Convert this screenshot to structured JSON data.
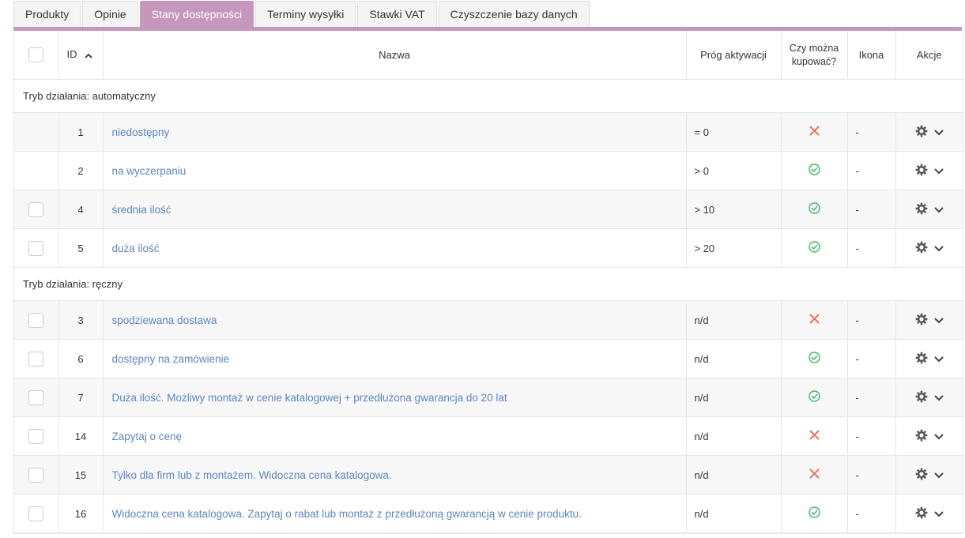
{
  "tabs": [
    {
      "label": "Produkty",
      "active": false
    },
    {
      "label": "Opinie",
      "active": false
    },
    {
      "label": "Stany dostępności",
      "active": true
    },
    {
      "label": "Terminy wysyłki",
      "active": false
    },
    {
      "label": "Stawki VAT",
      "active": false
    },
    {
      "label": "Czyszczenie bazy danych",
      "active": false
    }
  ],
  "colors": {
    "accent": "#c697bd",
    "link": "#5b86c5",
    "no": "#e8735f",
    "yes": "#3fb96a"
  },
  "table": {
    "headers": {
      "id": "ID",
      "name": "Nazwa",
      "threshold": "Próg aktywacji",
      "buyable_line1": "Czy można",
      "buyable_line2": "kupować?",
      "icon": "Ikona",
      "actions": "Akcje"
    },
    "groups": [
      {
        "title": "Tryb działania: automatyczny",
        "rows": [
          {
            "id": "1",
            "name": "niedostępny",
            "threshold": "= 0",
            "buyable": false,
            "icon": "-",
            "checkbox": false
          },
          {
            "id": "2",
            "name": "na wyczerpaniu",
            "threshold": "> 0",
            "buyable": true,
            "icon": "-",
            "checkbox": false
          },
          {
            "id": "4",
            "name": "średnia ilość",
            "threshold": "> 10",
            "buyable": true,
            "icon": "-",
            "checkbox": true
          },
          {
            "id": "5",
            "name": "duża ilość",
            "threshold": "> 20",
            "buyable": true,
            "icon": "-",
            "checkbox": true
          }
        ]
      },
      {
        "title": "Tryb działania: ręczny",
        "rows": [
          {
            "id": "3",
            "name": "spodziewana dostawa",
            "threshold": "n/d",
            "buyable": false,
            "icon": "-",
            "checkbox": true
          },
          {
            "id": "6",
            "name": "dostępny na zamówienie",
            "threshold": "n/d",
            "buyable": true,
            "icon": "-",
            "checkbox": true
          },
          {
            "id": "7",
            "name": "Duża ilość. Możliwy montaż w cenie katalogowej + przedłużona gwarancja do 20 lat",
            "threshold": "n/d",
            "buyable": true,
            "icon": "-",
            "checkbox": true
          },
          {
            "id": "14",
            "name": "Zapytaj o cenę",
            "threshold": "n/d",
            "buyable": false,
            "icon": "-",
            "checkbox": true
          },
          {
            "id": "15",
            "name": "Tylko dla firm lub z montażem. Widoczna cena katalogowa.",
            "threshold": "n/d",
            "buyable": false,
            "icon": "-",
            "checkbox": true
          },
          {
            "id": "16",
            "name": "Widoczna cena katalogowa. Zapytaj o rabat lub montaż z przedłużoną gwarancją w cenie produktu.",
            "threshold": "n/d",
            "buyable": true,
            "icon": "-",
            "checkbox": true
          }
        ]
      }
    ]
  }
}
